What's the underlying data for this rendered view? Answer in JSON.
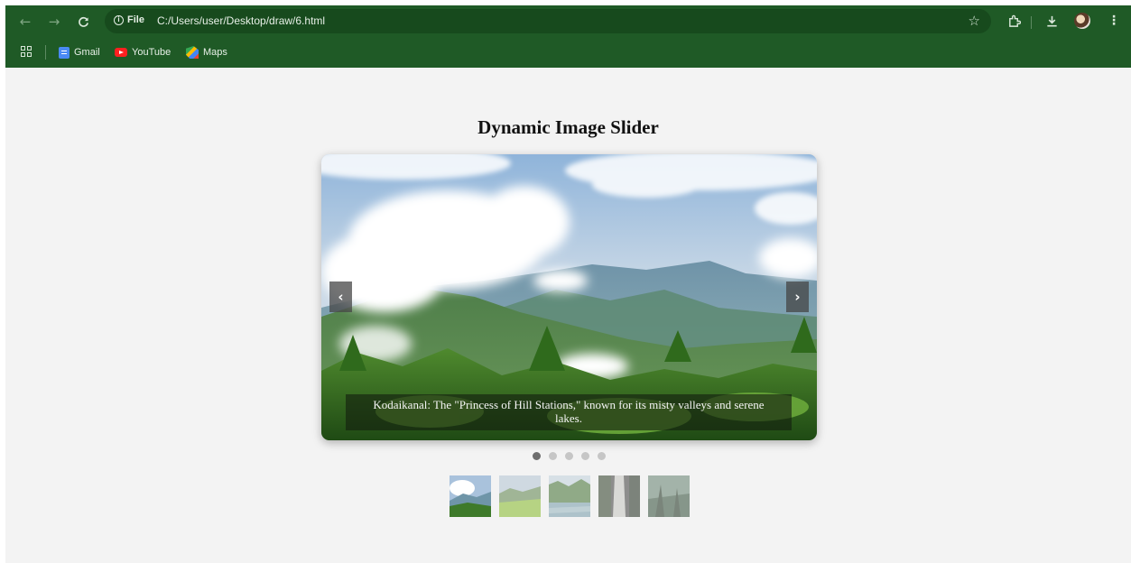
{
  "browser": {
    "nav": {
      "back_icon": "←",
      "forward_icon": "→",
      "reload_icon": "C"
    },
    "omnibox": {
      "info_label": "File",
      "url": "C:/Users/user/Desktop/draw/6.html"
    },
    "bookmarks": [
      {
        "label": "Gmail",
        "icon": "gmail-icon"
      },
      {
        "label": "YouTube",
        "icon": "youtube-icon"
      },
      {
        "label": "Maps",
        "icon": "maps-icon"
      }
    ],
    "toolbar_icons": [
      "star-icon",
      "extensions-icon",
      "download-icon",
      "profile-avatar",
      "menu-icon"
    ]
  },
  "page": {
    "title": "Dynamic Image Slider",
    "slider": {
      "caption": "Kodaikanal: The \"Princess of Hill Stations,\" known for its misty valleys and serene lakes.",
      "prev_icon": "‹",
      "next_icon": "›",
      "active_index": 0,
      "slide_count": 5
    }
  },
  "colors": {
    "chrome_bg": "#1f5a26",
    "page_bg": "#f3f3f3",
    "dot_active": "#6d6d6d",
    "dot_inactive": "#c6c6c6"
  }
}
